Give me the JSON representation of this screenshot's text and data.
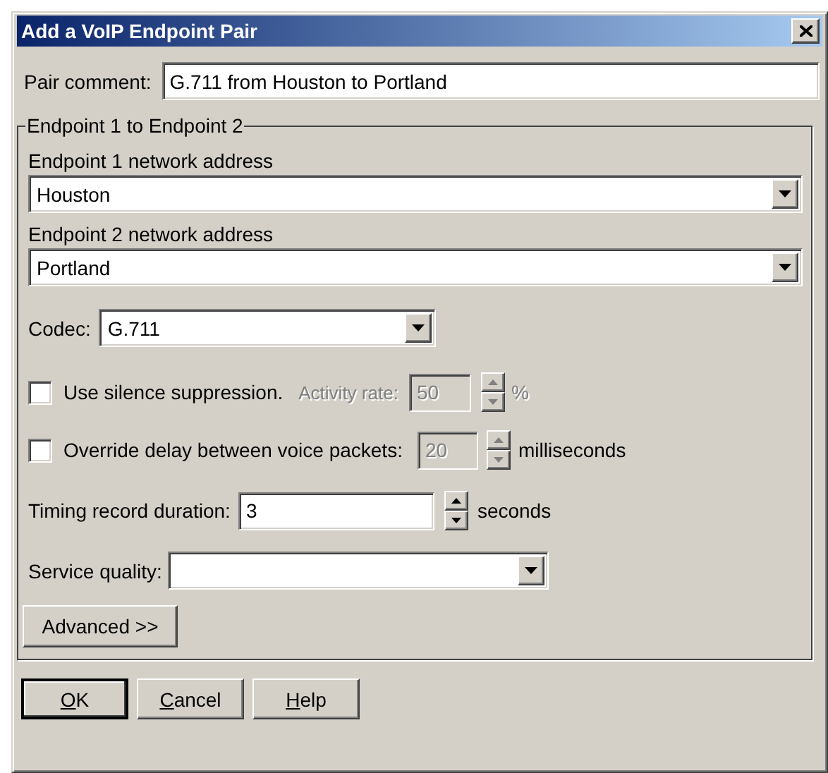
{
  "window": {
    "title": "Add a VoIP Endpoint Pair"
  },
  "pair_comment": {
    "label": "Pair comment:",
    "value": "G.711 from Houston to Portland"
  },
  "group": {
    "title": "Endpoint 1 to Endpoint 2",
    "endpoint1": {
      "label": "Endpoint 1 network address",
      "value": "Houston"
    },
    "endpoint2": {
      "label": "Endpoint 2 network address",
      "value": "Portland"
    },
    "codec": {
      "label": "Codec:",
      "value": "G.711"
    },
    "silence": {
      "label": "Use silence suppression.",
      "checked": false,
      "disabled": true,
      "rate_label": "Activity rate:",
      "rate_value": "50",
      "unit": "%"
    },
    "delay": {
      "label": "Override delay between voice packets:",
      "checked": false,
      "disabled": true,
      "value": "20",
      "unit": "milliseconds"
    },
    "timing": {
      "label": "Timing record duration:",
      "value": "3",
      "unit": "seconds"
    },
    "service": {
      "label": "Service quality:"
    },
    "advanced": {
      "label": "Advanced >>"
    }
  },
  "buttons": [
    {
      "label": "OK",
      "default": true,
      "mnemonic": true
    },
    {
      "label": "Cancel",
      "default": false,
      "mnemonic": true
    },
    {
      "label": "Help",
      "default": false,
      "mnemonic": true
    }
  ]
}
